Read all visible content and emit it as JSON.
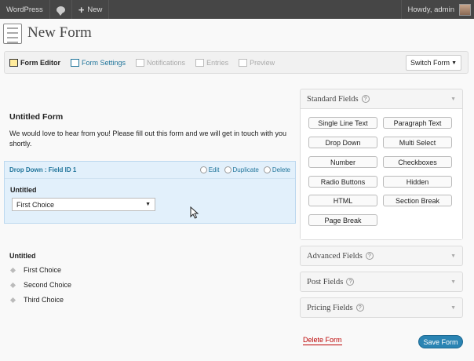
{
  "admin_bar": {
    "site_name": "WordPress",
    "new_label": "New",
    "greeting": "Howdy, admin"
  },
  "page": {
    "title": "New Form"
  },
  "toolbar": {
    "items": [
      {
        "label": "Form Editor",
        "icon": "form-editor-icon",
        "state": "active"
      },
      {
        "label": "Form Settings",
        "icon": "form-settings-icon",
        "state": "link"
      },
      {
        "label": "Notifications",
        "icon": "notifications-icon",
        "state": "disabled"
      },
      {
        "label": "Entries",
        "icon": "entries-icon",
        "state": "disabled"
      },
      {
        "label": "Preview",
        "icon": "preview-icon",
        "state": "disabled"
      }
    ],
    "switch_form": "Switch Form"
  },
  "form": {
    "title": "Untitled Form",
    "description": "We would love to hear from you! Please fill out this form and we will get in touch with you shortly.",
    "selected_field": {
      "header": "Drop Down : Field ID 1",
      "actions": [
        "Edit",
        "Duplicate",
        "Delete"
      ],
      "label": "Untitled",
      "selected_value": "First Choice"
    },
    "radio_field": {
      "label": "Untitled",
      "choices": [
        "First Choice",
        "Second Choice",
        "Third Choice"
      ]
    }
  },
  "sidebar": {
    "standard": {
      "title": "Standard Fields",
      "buttons": [
        "Single Line Text",
        "Paragraph Text",
        "Drop Down",
        "Multi Select",
        "Number",
        "Checkboxes",
        "Radio Buttons",
        "Hidden",
        "HTML",
        "Section Break",
        "Page Break"
      ]
    },
    "advanced": {
      "title": "Advanced Fields"
    },
    "post": {
      "title": "Post Fields"
    },
    "pricing": {
      "title": "Pricing Fields"
    }
  },
  "footer": {
    "delete_label": "Delete Form",
    "save_label": "Save Form"
  },
  "colors": {
    "accent": "#21759b",
    "save_button": "#2a84b3",
    "delete_link": "#bb0000",
    "selected_field_bg": "#e2f0fb"
  }
}
